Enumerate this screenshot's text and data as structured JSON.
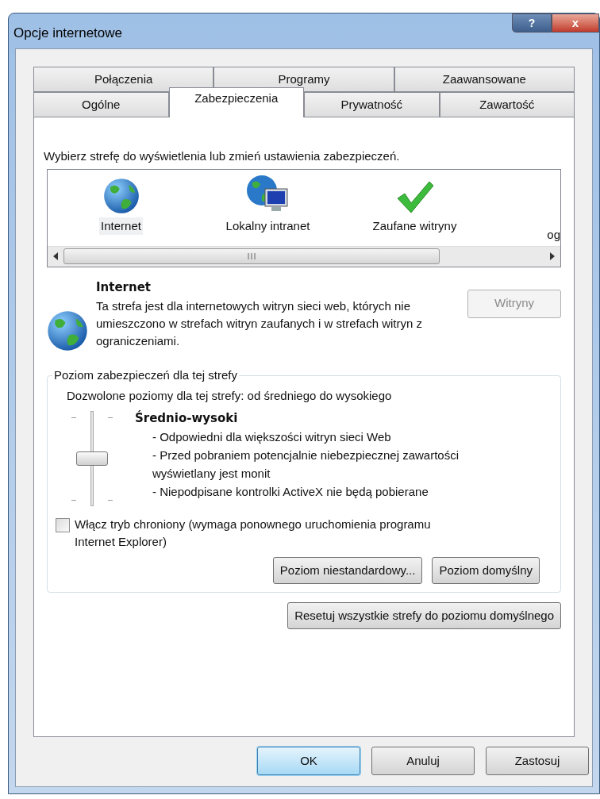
{
  "window": {
    "title": "Opcje internetowe",
    "controls": [
      "?",
      "x"
    ]
  },
  "tab_rows": [
    [
      {
        "label": "Połączenia",
        "selected": false
      },
      {
        "label": "Programy",
        "selected": false
      },
      {
        "label": "Zaawansowane",
        "selected": false
      }
    ],
    [
      {
        "label": "Ogólne",
        "selected": false
      },
      {
        "label": "Zabezpieczenia",
        "selected": true
      },
      {
        "label": "Prywatność",
        "selected": false
      },
      {
        "label": "Zawartość",
        "selected": false
      }
    ]
  ],
  "instruction": "Wybierz strefę do wyświetlenia lub zmień ustawienia zabezpieczeń.",
  "zones": [
    {
      "kind": "globe",
      "label": "Internet",
      "selected": true
    },
    {
      "kind": "network",
      "label": "Lokalny intranet",
      "selected": false
    },
    {
      "kind": "check",
      "label": "Zaufane witryny",
      "selected": false
    },
    {
      "kind": "partial",
      "label": "og",
      "selected": false
    }
  ],
  "zone_info": {
    "title": "Internet",
    "description": "Ta strefa jest dla internetowych witryn sieci web, których nie umieszczono w strefach witryn zaufanych i w strefach witryn z ograniczeniami.",
    "button": {
      "label": "Witryny",
      "disabled": true
    }
  },
  "security_level": {
    "group_title": "Poziom zabezpieczeń dla tej strefy",
    "allowed": "Dozwolone poziomy dla tej strefy: od średniego do wysokiego",
    "level": 0.5,
    "name": "Średnio-wysoki",
    "details": [
      "- Odpowiedni dla większości witryn sieci Web",
      "- Przed pobraniem potencjalnie niebezpiecznej zawartości wyświetlany jest monit",
      "- Niepodpisane kontrolki ActiveX nie będą pobierane"
    ],
    "protected_mode": {
      "label": "Włącz tryb chroniony (wymaga ponownego uruchomienia programu Internet Explorer)",
      "checked": false
    },
    "buttons": [
      "Poziom niestandardowy...",
      "Poziom domyślny"
    ]
  },
  "reset_button": "Resetuj wszystkie strefy do poziomu domyślnego",
  "dialog_buttons": [
    {
      "label": "OK",
      "default": true
    },
    {
      "label": "Anuluj",
      "default": false
    },
    {
      "label": "Zastosuj",
      "default": false
    }
  ]
}
